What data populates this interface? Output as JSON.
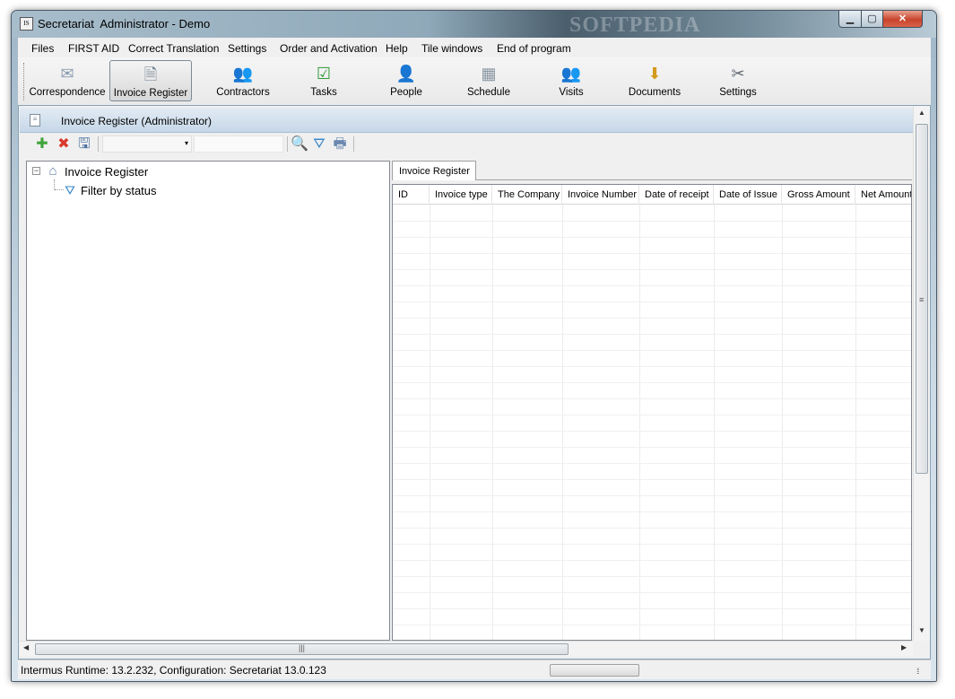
{
  "window": {
    "title": "Secretariat  Administrator - Demo",
    "watermark": "SOFTPEDIA",
    "app_icon_text": "IS",
    "minimize_glyph": "▁",
    "maximize_glyph": "▢",
    "close_glyph": "✕"
  },
  "menu": {
    "items": [
      "Files",
      "FIRST AID",
      "Correct Translation",
      "Settings",
      "Order and Activation",
      "Help",
      "Tile windows",
      "End of program"
    ]
  },
  "toolbar": {
    "buttons": [
      {
        "label": "Correspondence",
        "icon": "envelope-icon",
        "glyph": "✉"
      },
      {
        "label": "Invoice Register",
        "icon": "invoice-icon",
        "glyph": "🗎",
        "active": true
      },
      {
        "label": "Contractors",
        "icon": "contractors-icon",
        "glyph": "👥"
      },
      {
        "label": "Tasks",
        "icon": "tasks-icon",
        "glyph": "☑"
      },
      {
        "label": "People",
        "icon": "people-icon",
        "glyph": "👤"
      },
      {
        "label": "Schedule",
        "icon": "schedule-icon",
        "glyph": "▦"
      },
      {
        "label": "Visits",
        "icon": "visits-icon",
        "glyph": "👥"
      },
      {
        "label": "Documents",
        "icon": "documents-icon",
        "glyph": "⬇"
      },
      {
        "label": "Settings",
        "icon": "settings-icon",
        "glyph": "✂"
      }
    ]
  },
  "panel": {
    "title": "Invoice Register (Administrator)",
    "header_icon_glyph": "≡"
  },
  "subtoolbar": {
    "add_glyph": "✚",
    "delete_glyph": "✖",
    "save_glyph": "🖫",
    "combo_value": "",
    "combo_arrow": "▾",
    "search_value": "",
    "search_glyph": "🔍",
    "filter_glyph": "⛛",
    "print_glyph": "🖶"
  },
  "tree": {
    "expander": "−",
    "root_icon_glyph": "⌂",
    "filter_icon_glyph": "⛛",
    "root": "Invoice Register",
    "children": [
      "Filter by status"
    ]
  },
  "tabs": [
    "Invoice Register"
  ],
  "grid": {
    "columns": [
      "ID",
      "Invoice type",
      "The Company",
      "Invoice Number",
      "Date of receipt",
      "Date of Issue",
      "Gross Amount",
      "Net Amount"
    ],
    "rows": []
  },
  "scroll": {
    "up": "▲",
    "down": "▼",
    "left": "◀",
    "right": "▶",
    "vgrip": "≡",
    "hgrip": "|||"
  },
  "statusbar": {
    "text": "Intermus Runtime: 13.2.232, Configuration: Secretariat 13.0.123",
    "grip": "⁞⁞⁞"
  }
}
